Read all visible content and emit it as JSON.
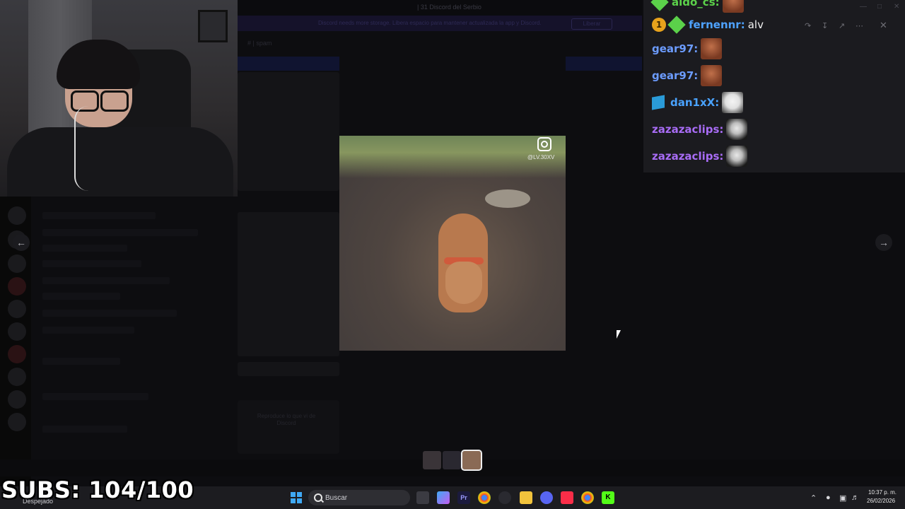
{
  "background": {
    "title": "| 31 Discord del Serbio",
    "banner_text": "Discord needs more storage. Libera espacio para mantener actualizada la app y Discord.",
    "banner_button": "Liberar",
    "channel_name": "# | spam",
    "caption_text": "Reproduce lo que vi de Discord"
  },
  "media": {
    "instagram_handle": "@LV.30XV"
  },
  "chat": {
    "messages": [
      {
        "user": "aldo_cs:",
        "user_color": "#5bd14a",
        "text": "",
        "emote": "face",
        "badges": [
          "gem"
        ]
      },
      {
        "user": "fernennr:",
        "user_color": "#4ea2ff",
        "text": "alv",
        "emote": "",
        "badges": [
          "1",
          "gem"
        ]
      },
      {
        "user": "gear97:",
        "user_color": "#6c9cff",
        "text": "",
        "emote": "face",
        "badges": []
      },
      {
        "user": "gear97:",
        "user_color": "#6c9cff",
        "text": "",
        "emote": "face",
        "badges": []
      },
      {
        "user": "dan1xX:",
        "user_color": "#4aa3ff",
        "text": "",
        "emote": "dog",
        "badges": [
          "cube"
        ]
      },
      {
        "user": "zazazaclips:",
        "user_color": "#a86cf5",
        "text": "",
        "emote": "cat",
        "badges": []
      },
      {
        "user": "zazazaclips:",
        "user_color": "#a86cf5",
        "text": "",
        "emote": "cat",
        "badges": []
      }
    ]
  },
  "overlay": {
    "subs_counter": "SUBS: 104/100"
  },
  "taskbar": {
    "weather": "Despejado",
    "search_placeholder": "Buscar",
    "time": "10:37 p. m.",
    "date": "26/02/2026"
  },
  "colors": {
    "accent_blue": "#3fa9f5",
    "subs_text": "#ffffff"
  }
}
